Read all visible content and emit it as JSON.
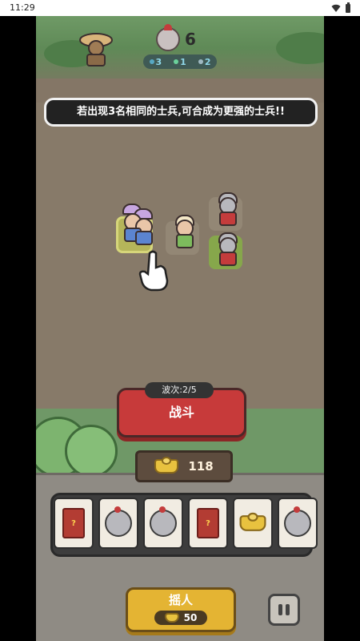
{
  "status_bar": {
    "time": "11:29",
    "icons": [
      "wifi-icon",
      "battery-icon"
    ]
  },
  "hud": {
    "soldier_count": "6",
    "kills": [
      {
        "icon": "blue-orb-icon",
        "value": "3"
      },
      {
        "icon": "archer-icon",
        "value": "1"
      },
      {
        "icon": "sword-icon",
        "value": "2"
      }
    ]
  },
  "tip_text": "若出现3名相同的士兵,可合成为更强的士兵!!",
  "wave": {
    "label": "波次:2/5"
  },
  "battle_button": "战斗",
  "gold": "118",
  "cards": [
    {
      "type": "mystery-card",
      "symbol": "?"
    },
    {
      "type": "knight"
    },
    {
      "type": "knight"
    },
    {
      "type": "mystery-card",
      "symbol": "?"
    },
    {
      "type": "gold-ingot"
    },
    {
      "type": "knight"
    }
  ],
  "shake_button": {
    "label": "摇人",
    "cost": "50"
  },
  "colors": {
    "battle_red": "#c73a3a",
    "shake_yellow": "#e4b433",
    "board_brown": "#877a69"
  }
}
